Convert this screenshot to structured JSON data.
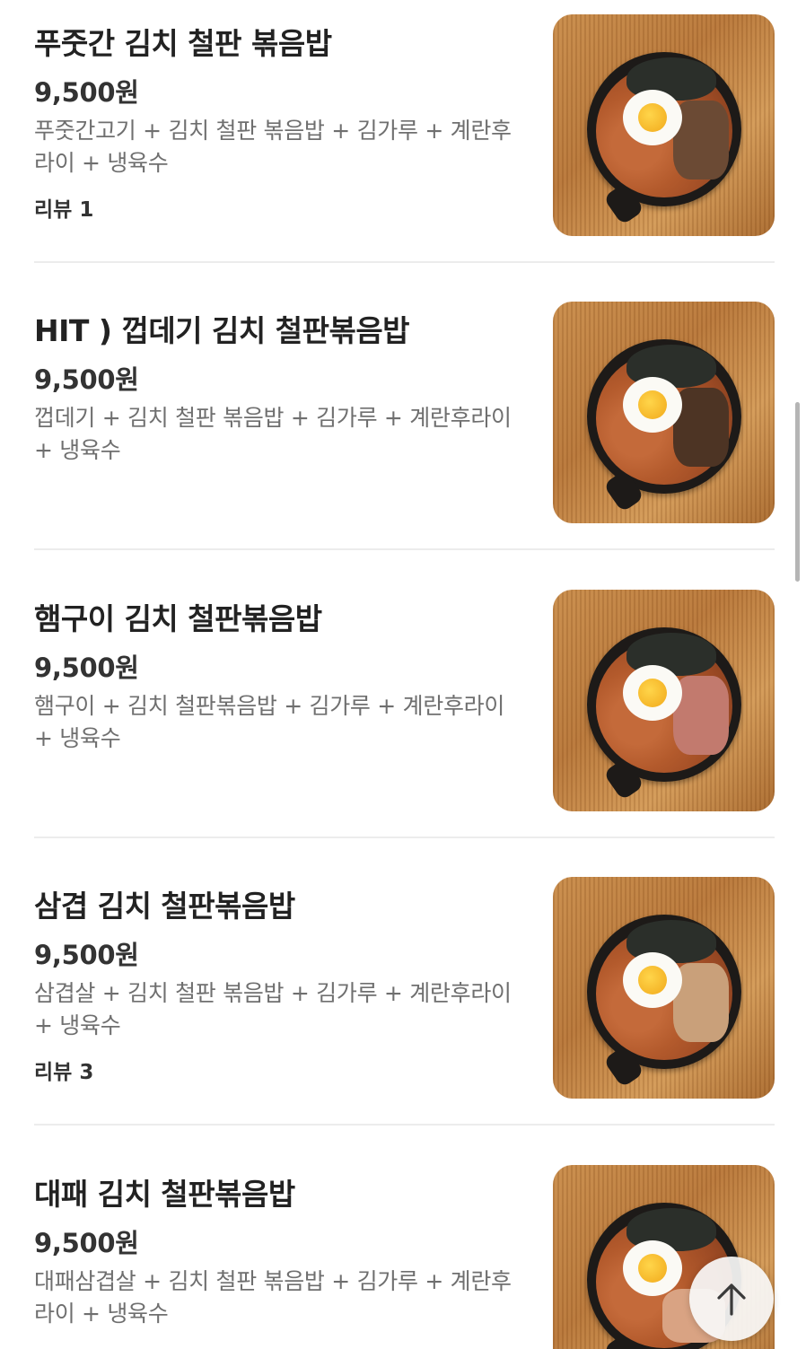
{
  "menu": {
    "items": [
      {
        "name": "푸줏간 김치 철판 볶음밥",
        "price": "9,500원",
        "description": "푸줏간고기 + 김치 철판 볶음밥 + 김가루 + 계란후라이 + 냉육수",
        "review": "리뷰 1",
        "image_icon": "fried-rice-photo"
      },
      {
        "name": "HIT ) 껍데기 김치 철판볶음밥",
        "price": "9,500원",
        "description": "껍데기 + 김치 철판 볶음밥 + 김가루 + 계란후라이 + 냉육수",
        "review": "",
        "image_icon": "fried-rice-photo"
      },
      {
        "name": "햄구이 김치 철판볶음밥",
        "price": "9,500원",
        "description": "햄구이 + 김치 철판볶음밥 + 김가루 + 계란후라이 + 냉육수",
        "review": "",
        "image_icon": "fried-rice-photo"
      },
      {
        "name": "삼겹 김치 철판볶음밥",
        "price": "9,500원",
        "description": "삼겹살 + 김치 철판 볶음밥 + 김가루 + 계란후라이 + 냉육수",
        "review": "리뷰 3",
        "image_icon": "fried-rice-photo"
      },
      {
        "name": "대패 김치 철판볶음밥",
        "price": "9,500원",
        "description": "대패삼겹살 + 김치 철판 볶음밥 + 김가루 + 계란후라이 + 냉육수",
        "review": "",
        "image_icon": "fried-rice-photo"
      }
    ]
  },
  "scroll_top_button": {
    "icon": "arrow-up-icon"
  },
  "colors": {
    "title": "#222222",
    "description": "#6f6f6f",
    "divider": "#ececec",
    "board": "#c98d4c"
  }
}
